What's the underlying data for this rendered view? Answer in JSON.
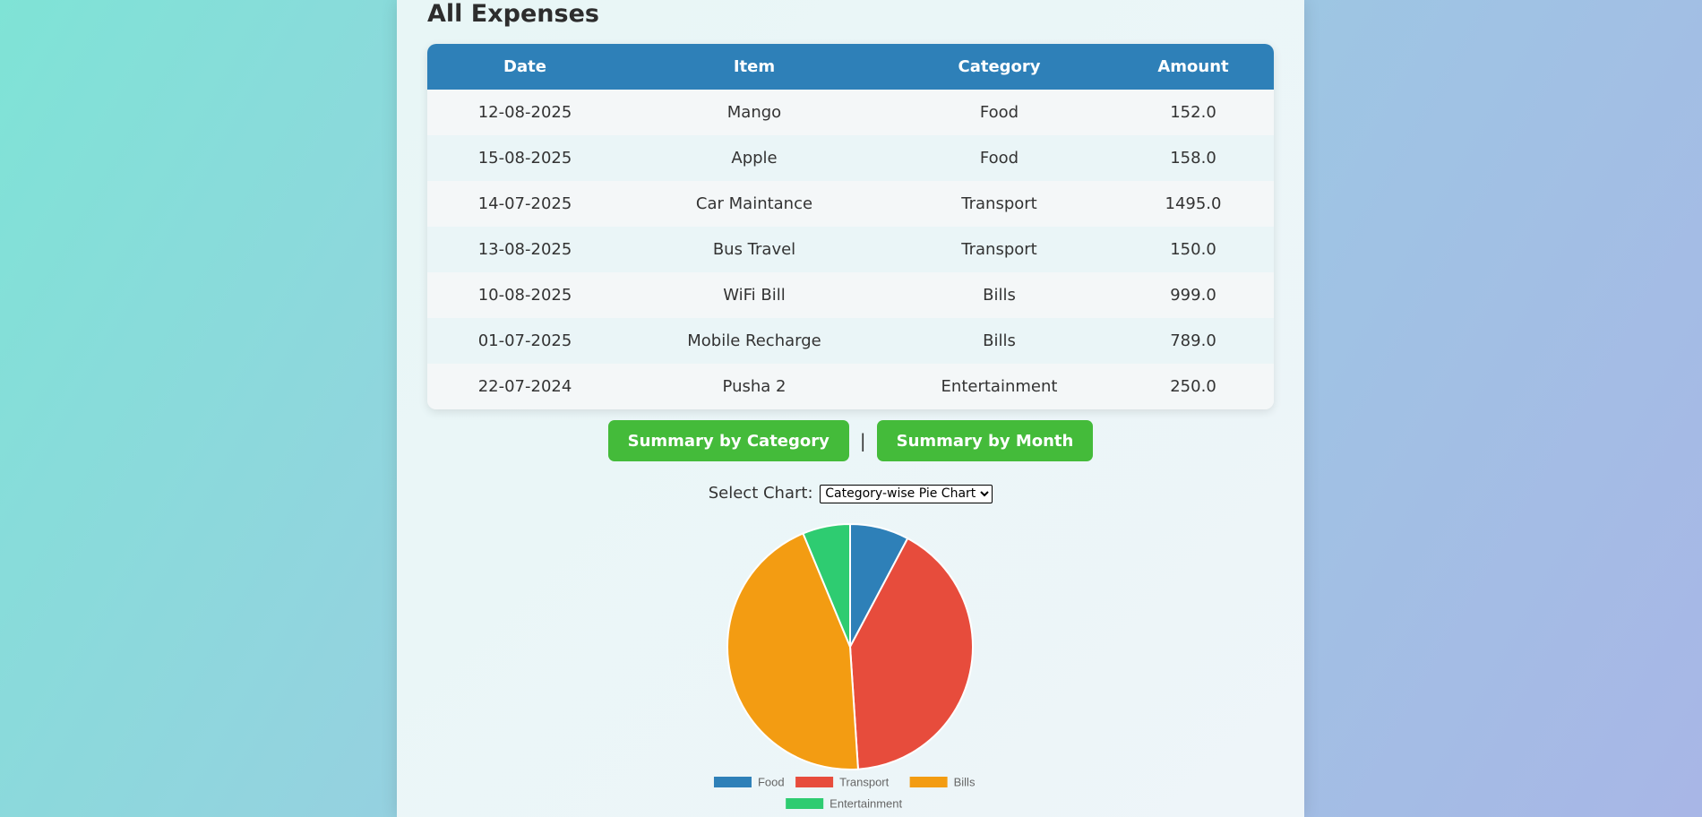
{
  "page": {
    "title": "All Expenses"
  },
  "table": {
    "headers": [
      "Date",
      "Item",
      "Category",
      "Amount"
    ],
    "rows": [
      [
        "12-08-2025",
        "Mango",
        "Food",
        "152.0"
      ],
      [
        "15-08-2025",
        "Apple",
        "Food",
        "158.0"
      ],
      [
        "14-07-2025",
        "Car Maintance",
        "Transport",
        "1495.0"
      ],
      [
        "13-08-2025",
        "Bus Travel",
        "Transport",
        "150.0"
      ],
      [
        "10-08-2025",
        "WiFi Bill",
        "Bills",
        "999.0"
      ],
      [
        "01-07-2025",
        "Mobile Recharge",
        "Bills",
        "789.0"
      ],
      [
        "22-07-2024",
        "Pusha 2",
        "Entertainment",
        "250.0"
      ]
    ]
  },
  "buttons": {
    "summary_category": "Summary by Category",
    "separator": "|",
    "summary_month": "Summary by Month"
  },
  "chart_select": {
    "label": "Select Chart:",
    "selected": "Category-wise Pie Chart"
  },
  "chart_data": {
    "type": "pie",
    "categories": [
      "Food",
      "Transport",
      "Bills",
      "Entertainment"
    ],
    "values": [
      310,
      1645,
      1788,
      250
    ],
    "colors": [
      "#2e80b8",
      "#e74c3c",
      "#f39c12",
      "#2ecc71"
    ],
    "legend_position": "bottom"
  }
}
